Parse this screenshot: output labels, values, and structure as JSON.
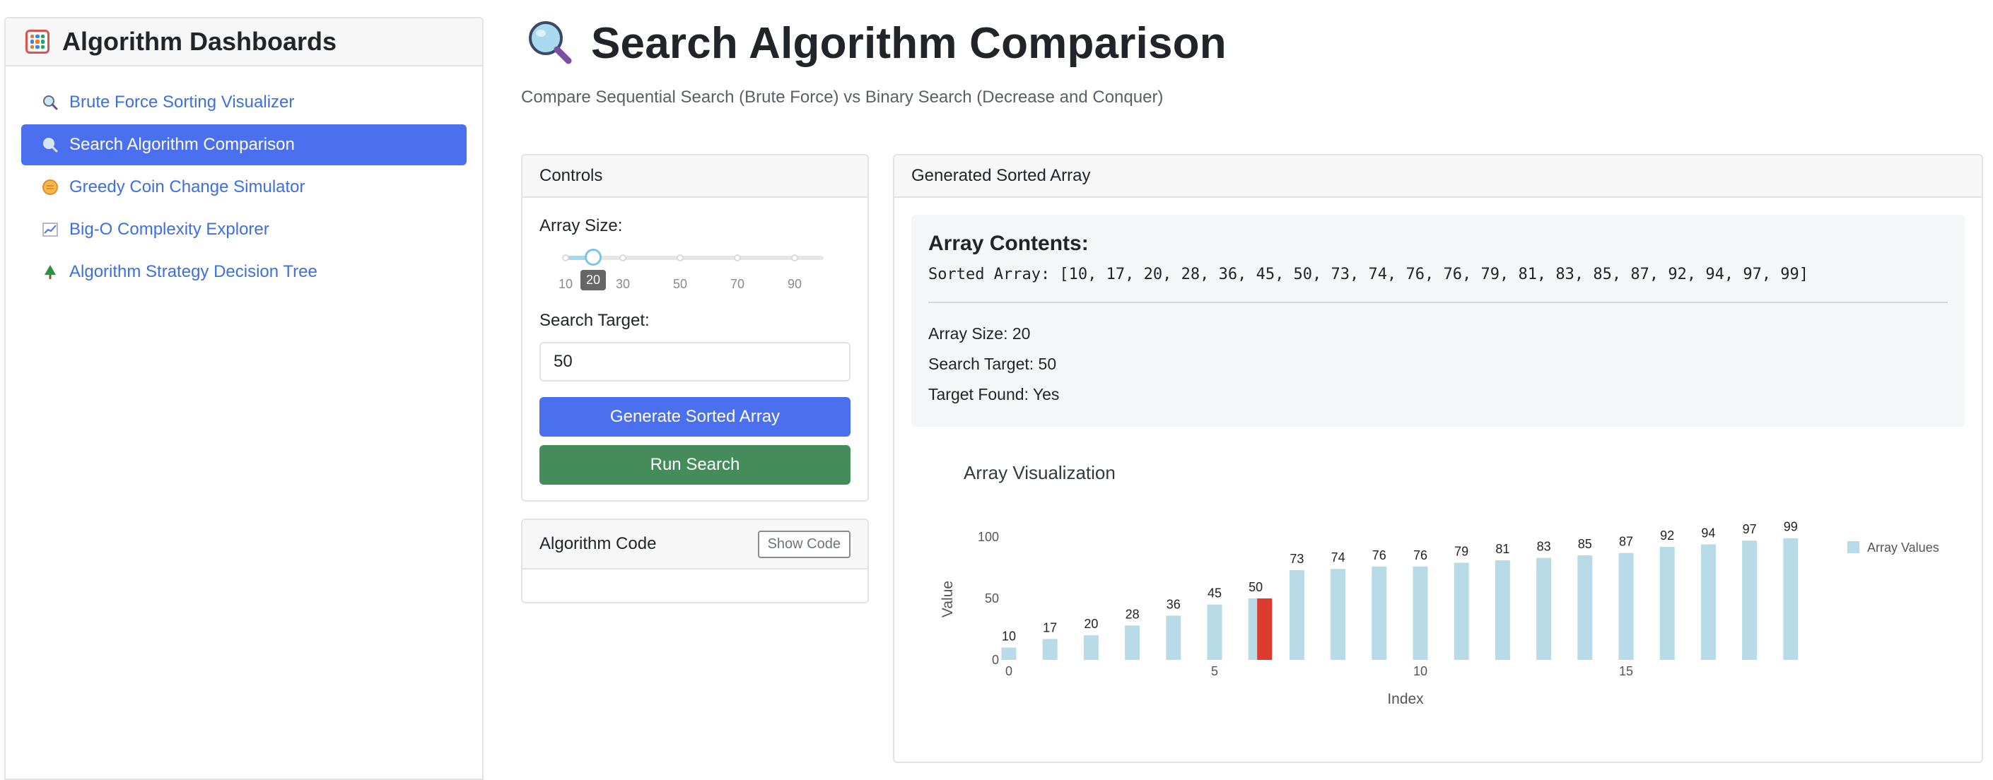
{
  "sidebar": {
    "title": "Algorithm Dashboards",
    "items": [
      {
        "label": "Brute Force Sorting Visualizer",
        "icon": "magnifier-icon"
      },
      {
        "label": "Search Algorithm Comparison",
        "icon": "magnifier-icon"
      },
      {
        "label": "Greedy Coin Change Simulator",
        "icon": "coin-icon"
      },
      {
        "label": "Big-O Complexity Explorer",
        "icon": "chart-icon"
      },
      {
        "label": "Algorithm Strategy Decision Tree",
        "icon": "tree-icon"
      }
    ]
  },
  "page": {
    "title": "Search Algorithm Comparison",
    "subtitle": "Compare Sequential Search (Brute Force) vs Binary Search (Decrease and Conquer)"
  },
  "controls": {
    "header": "Controls",
    "array_size_label": "Array Size:",
    "slider_marks": [
      "10",
      "30",
      "50",
      "70",
      "90"
    ],
    "slider_value": "20",
    "search_target_label": "Search Target:",
    "search_target_value": "50",
    "generate_button": "Generate Sorted Array",
    "run_button": "Run Search"
  },
  "code": {
    "header": "Algorithm Code",
    "show_button": "Show Code"
  },
  "array": {
    "header": "Generated Sorted Array",
    "contents_title": "Array Contents:",
    "sorted_line": "Sorted Array: [10, 17, 20, 28, 36, 45, 50, 73, 74, 76, 76, 79, 81, 83, 85, 87, 92, 94, 97, 99]",
    "size_line": "Array Size: 20",
    "target_line": "Search Target: 50",
    "found_line": "Target Found: Yes"
  },
  "chart_data": {
    "type": "bar",
    "title": "Array Visualization",
    "xlabel": "Index",
    "ylabel": "Value",
    "legend": "Array Values",
    "legend_position": "top-right",
    "x": [
      0,
      1,
      2,
      3,
      4,
      5,
      6,
      7,
      8,
      9,
      10,
      11,
      12,
      13,
      14,
      15,
      16,
      17,
      18,
      19
    ],
    "values": [
      10,
      17,
      20,
      28,
      36,
      45,
      50,
      73,
      74,
      76,
      76,
      79,
      81,
      83,
      85,
      87,
      92,
      94,
      97,
      99
    ],
    "highlight_index": 6,
    "highlight_value": 50,
    "x_ticks": [
      "0",
      "5",
      "10",
      "15"
    ],
    "y_ticks": [
      "0",
      "50",
      "100"
    ],
    "ylim": [
      0,
      100
    ],
    "bar_color": "#b9dae7",
    "highlight_color": "#dd3b2e"
  }
}
